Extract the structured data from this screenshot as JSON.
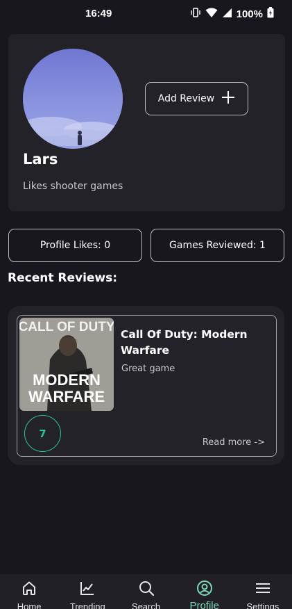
{
  "status_bar": {
    "time": "16:49",
    "battery": "100%",
    "icons": [
      "vibrate-icon",
      "wifi-icon",
      "signal-icon",
      "battery-icon"
    ]
  },
  "profile": {
    "username": "Lars",
    "bio": "Likes shooter games",
    "add_review_label": "Add Review"
  },
  "stats": {
    "likes_label": "Profile Likes: 0",
    "reviewed_label": "Games Reviewed: 1"
  },
  "recent_reviews": {
    "title": "Recent Reviews:",
    "items": [
      {
        "cover_title_top": "CALL OF DUTY",
        "cover_title_bottom_1": "MODERN",
        "cover_title_bottom_2": "WARFARE",
        "game_title": "Call Of Duty: Modern Warfare",
        "review": "Great game",
        "score": "7",
        "read_more": "Read more ->"
      }
    ]
  },
  "nav": {
    "items": [
      {
        "label": "Home",
        "icon": "home-icon"
      },
      {
        "label": "Trending",
        "icon": "trending-icon"
      },
      {
        "label": "Search",
        "icon": "search-icon"
      },
      {
        "label": "Profile",
        "icon": "profile-icon",
        "active": true
      },
      {
        "label": "Settings",
        "icon": "settings-icon"
      }
    ]
  },
  "colors": {
    "background": "#18171d",
    "card": "#232229",
    "accent": "#29c49a",
    "nav_active": "#7fd7b8"
  }
}
